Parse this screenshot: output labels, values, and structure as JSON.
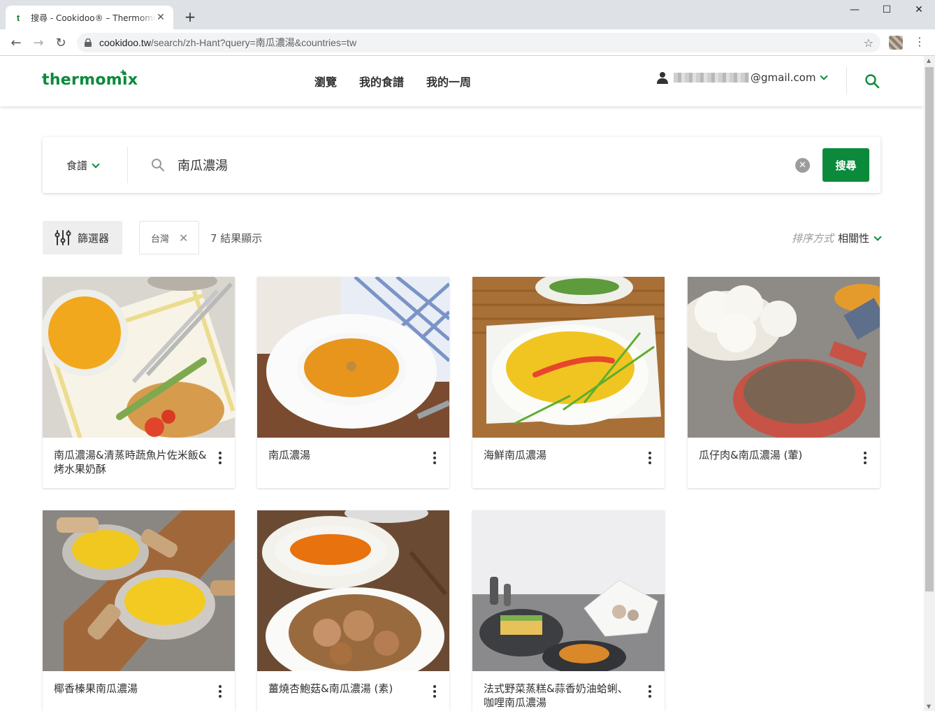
{
  "browser": {
    "tab_title": "搜尋 - Cookidoo® – Thermomix",
    "tab_favicon": "t",
    "url_host": "cookidoo.tw",
    "url_path": "/search/zh-Hant?query=南瓜濃湯&countries=tw"
  },
  "header": {
    "logo": "thermomix",
    "nav": [
      "瀏覽",
      "我的食譜",
      "我的一周"
    ],
    "account_email": "@gmail.com"
  },
  "search": {
    "scope": "食譜",
    "query": "南瓜濃湯",
    "button_label": "搜尋"
  },
  "filters": {
    "filter_button": "篩選器",
    "chip_label": "台灣",
    "results_text": "7 結果顯示",
    "sort_label": "排序方式",
    "sort_value": "相關性"
  },
  "recipes": [
    {
      "title": "南瓜濃湯&清蒸時蔬魚片佐米飯&烤水果奶酥",
      "image": "pumpkin-soup-with-fish-rice-plate"
    },
    {
      "title": "南瓜濃湯",
      "image": "pumpkin-soup-white-bowl"
    },
    {
      "title": "海鮮南瓜濃湯",
      "image": "seafood-pumpkin-soup-shrimp"
    },
    {
      "title": "瓜仔肉&南瓜濃湯 (葷)",
      "image": "minced-pork-and-steamed-buns"
    },
    {
      "title": "椰香榛果南瓜濃湯",
      "image": "coconut-hazelnut-pumpkin-soup-bowls"
    },
    {
      "title": "薑燒杏鮑菇&南瓜濃湯 (素)",
      "image": "ginger-king-oyster-mushroom"
    },
    {
      "title": "法式野菜蒸糕&蒜香奶油蛤蜊、咖哩南瓜濃湯",
      "image": "vegetable-terrine-clams-curry-soup"
    }
  ],
  "colors": {
    "brand_green": "#0b8a3c",
    "chrome_bg": "#dee1e6"
  }
}
